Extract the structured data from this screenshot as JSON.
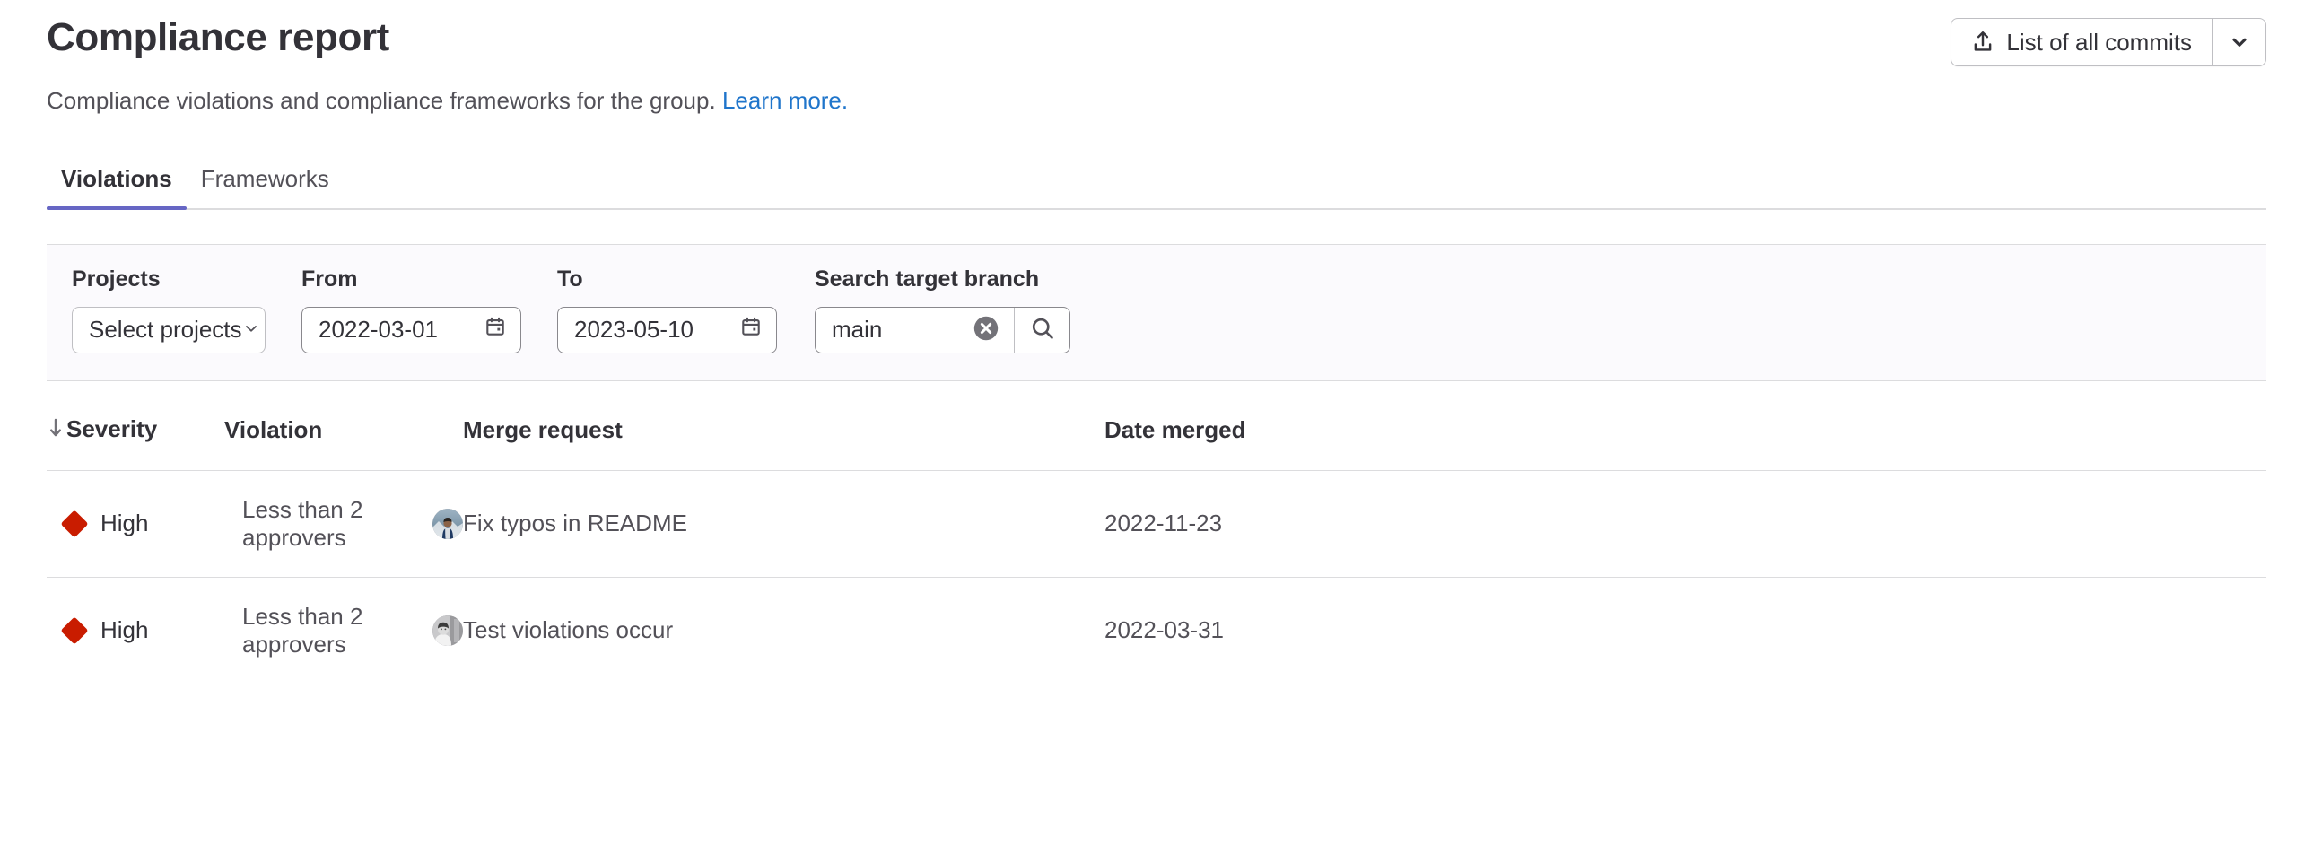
{
  "header": {
    "title": "Compliance report",
    "subtitle_text": "Compliance violations and compliance frameworks for the group.",
    "learn_more_label": "Learn more."
  },
  "actions": {
    "export_button_label": "List of all commits",
    "export_icon": "export-icon",
    "caret_icon": "chevron-down-icon"
  },
  "tabs": [
    {
      "label": "Violations",
      "active": true
    },
    {
      "label": "Frameworks",
      "active": false
    }
  ],
  "filters": {
    "projects": {
      "label": "Projects",
      "value": "Select projects",
      "caret_icon": "chevron-down-icon"
    },
    "from": {
      "label": "From",
      "value": "2022-03-01",
      "icon": "calendar-icon"
    },
    "to": {
      "label": "To",
      "value": "2023-05-10",
      "icon": "calendar-icon"
    },
    "branch": {
      "label": "Search target branch",
      "value": "main",
      "placeholder": "Search target branch",
      "clear_icon": "clear-circle-icon",
      "search_icon": "search-icon"
    }
  },
  "table": {
    "sort_indicator": "↓",
    "columns": [
      {
        "key": "severity",
        "label": "Severity",
        "sorted": true
      },
      {
        "key": "violation",
        "label": "Violation",
        "sorted": false
      },
      {
        "key": "merge_request",
        "label": "Merge request",
        "sorted": false
      },
      {
        "key": "date_merged",
        "label": "Date merged",
        "sorted": false
      }
    ],
    "rows": [
      {
        "severity": "High",
        "severity_color": "#c91c00",
        "violation": "Less than 2 approvers",
        "avatar": "user-avatar",
        "merge_request": "Fix typos in README",
        "date_merged": "2022-11-23"
      },
      {
        "severity": "High",
        "severity_color": "#c91c00",
        "violation": "Less than 2 approvers",
        "avatar": "user-avatar",
        "merge_request": "Test violations occur",
        "date_merged": "2022-03-31"
      }
    ]
  },
  "colors": {
    "accent": "#6666c4",
    "link": "#1f75cb",
    "severity_high": "#c91c00",
    "filter_bar_bg": "#fbfafd",
    "border": "#dcdcde"
  }
}
